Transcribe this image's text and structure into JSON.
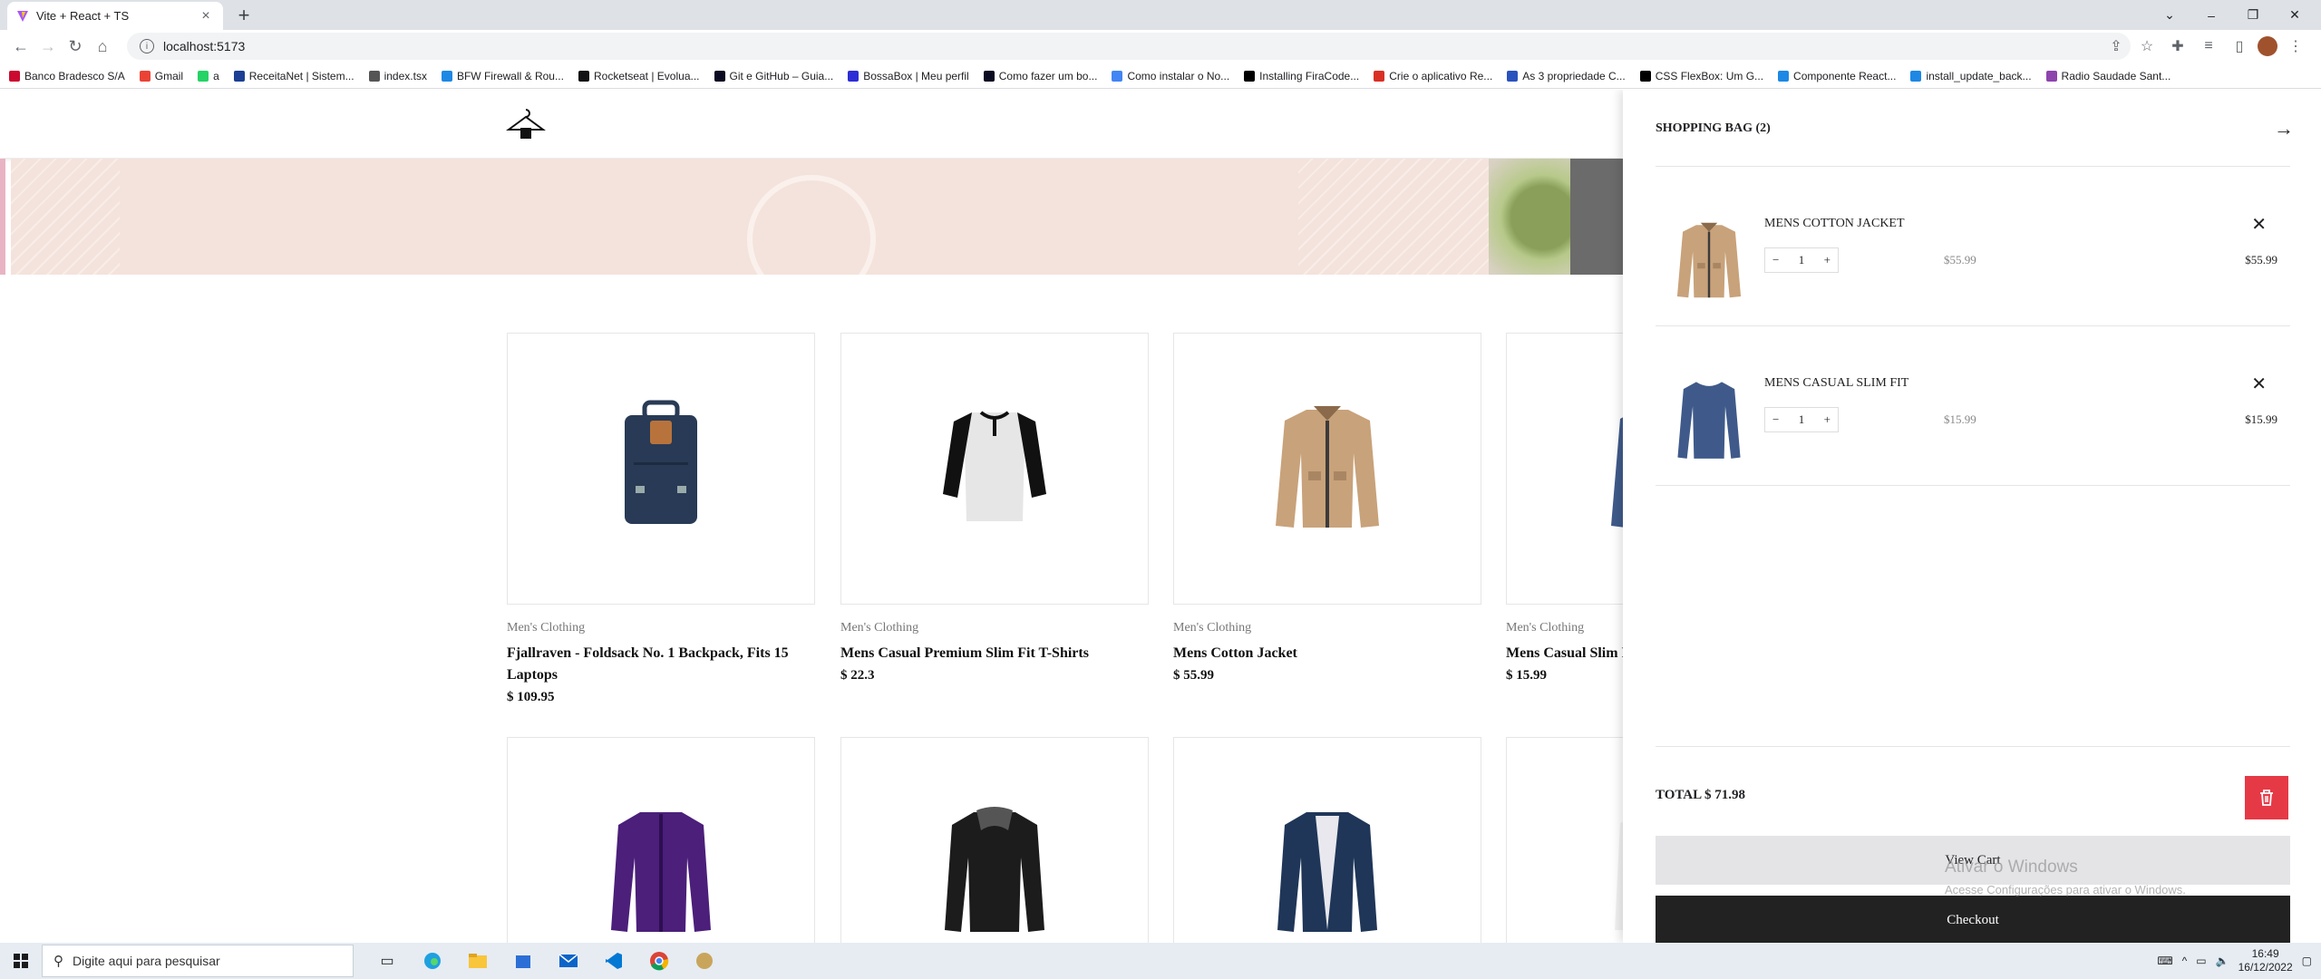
{
  "browser": {
    "tab_title": "Vite + React + TS",
    "new_tab": "+",
    "url": "localhost:5173",
    "bookmarks": [
      {
        "label": "Banco Bradesco S/A",
        "color": "#cc092f"
      },
      {
        "label": "Gmail",
        "color": "#ea4335"
      },
      {
        "label": "a",
        "color": "#25d366"
      },
      {
        "label": "ReceitaNet | Sistem...",
        "color": "#1c3f94"
      },
      {
        "label": "index.tsx",
        "color": "#555555"
      },
      {
        "label": "BFW Firewall & Rou...",
        "color": "#1e88e5"
      },
      {
        "label": "Rocketseat | Evolua...",
        "color": "#121214"
      },
      {
        "label": "Git e GitHub – Guia...",
        "color": "#0a0a23"
      },
      {
        "label": "BossaBox | Meu perfil",
        "color": "#2d2dd6"
      },
      {
        "label": "Como fazer um bo...",
        "color": "#0a0a23"
      },
      {
        "label": "Como instalar o No...",
        "color": "#4285f4"
      },
      {
        "label": "Installing FiraCode...",
        "color": "#000000"
      },
      {
        "label": "Crie o aplicativo Re...",
        "color": "#d93025"
      },
      {
        "label": "As 3 propriedade C...",
        "color": "#2a52be"
      },
      {
        "label": "CSS FlexBox: Um G...",
        "color": "#000000"
      },
      {
        "label": "Componente React...",
        "color": "#1e88e5"
      },
      {
        "label": "install_update_back...",
        "color": "#1e88e5"
      },
      {
        "label": "Radio Saudade Sant...",
        "color": "#8e44ad"
      }
    ]
  },
  "banner_colors": {
    "bg": "#f4e3dc"
  },
  "products": [
    {
      "category": "Men's Clothing",
      "name": "Fjallraven - Foldsack No. 1 Backpack, Fits 15 Laptops",
      "price": "$ 109.95",
      "image": "backpack-icon"
    },
    {
      "category": "Men's Clothing",
      "name": "Mens Casual Premium Slim Fit T-Shirts",
      "price": "$ 22.3",
      "image": "raglan-shirt-icon"
    },
    {
      "category": "Men's Clothing",
      "name": "Mens Cotton Jacket",
      "price": "$ 55.99",
      "image": "cotton-jacket-icon"
    },
    {
      "category": "Men's Clothing",
      "name": "Mens Casual Slim Fit",
      "price": "$ 15.99",
      "image": "slim-fit-shirt-icon"
    },
    {
      "image": "purple-jacket-icon"
    },
    {
      "image": "leather-jacket-icon"
    },
    {
      "image": "navy-coat-icon"
    },
    {
      "image": "white-top-icon"
    }
  ],
  "cart": {
    "title": "SHOPPING BAG (2)",
    "items": [
      {
        "name": "MENS COTTON JACKET",
        "qty": "1",
        "unit_price": "$55.99",
        "line_total": "$55.99",
        "image": "cotton-jacket-icon"
      },
      {
        "name": "MENS CASUAL SLIM FIT",
        "qty": "1",
        "unit_price": "$15.99",
        "line_total": "$15.99",
        "image": "slim-fit-shirt-icon"
      }
    ],
    "total": "TOTAL  $ 71.98",
    "view_cart": "View Cart",
    "checkout": "Checkout"
  },
  "watermark": {
    "title": "Ativar o Windows",
    "subtitle": "Acesse Configurações para ativar o Windows."
  },
  "taskbar": {
    "search_placeholder": "Digite aqui para pesquisar",
    "time": "16:49",
    "date": "16/12/2022"
  }
}
